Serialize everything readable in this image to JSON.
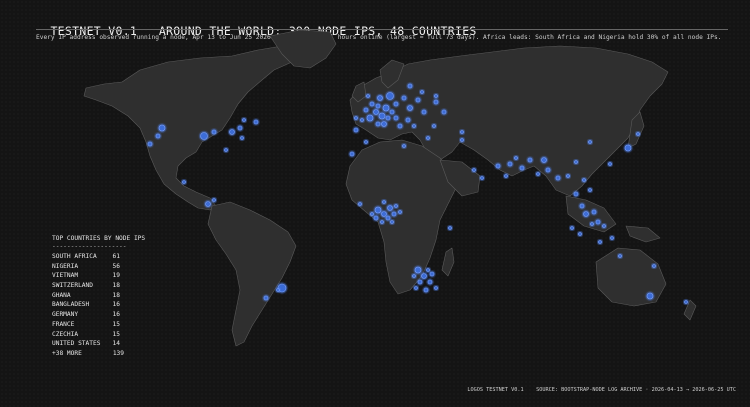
{
  "header": {
    "title_left": "TESTNET V0.1",
    "title_right": "AROUND THE WORLD: 390 NODE IPS, 48 COUNTRIES",
    "subtitle": "Every IP address observed running a node, Apr 13 to Jun 25 2026. Dot size: total hours online (largest = full 73 days). Africa leads: South Africa and Nigeria hold 30% of all node IPs."
  },
  "colors": {
    "background": "#141414",
    "land": "#2f2f2f",
    "coast": "#5a5a5a",
    "node_fill": "#3b6fe0",
    "node_ring": "#7aa2ff"
  },
  "country_panel": {
    "heading": "TOP COUNTRIES BY NODE IPS",
    "divider": "--------------------",
    "rows": [
      {
        "country": "SOUTH AFRICA",
        "count": "61"
      },
      {
        "country": "NIGERIA",
        "count": "56"
      },
      {
        "country": "VIETNAM",
        "count": "19"
      },
      {
        "country": "SWITZERLAND",
        "count": "18"
      },
      {
        "country": "GHANA",
        "count": "18"
      },
      {
        "country": "BANGLADESH",
        "count": "16"
      },
      {
        "country": "GERMANY",
        "count": "16"
      },
      {
        "country": "FRANCE",
        "count": "15"
      },
      {
        "country": "CZECHIA",
        "count": "15"
      },
      {
        "country": "UNITED STATES",
        "count": "14"
      },
      {
        "country": "+38 MORE",
        "count": "139"
      }
    ]
  },
  "footer": {
    "credit": "LOGOS TESTNET V0.1",
    "source": "SOURCE: BOOTSTRAP-NODE LOG ARCHIVE · 2026-04-13 → 2026-06-25 UTC"
  }
}
